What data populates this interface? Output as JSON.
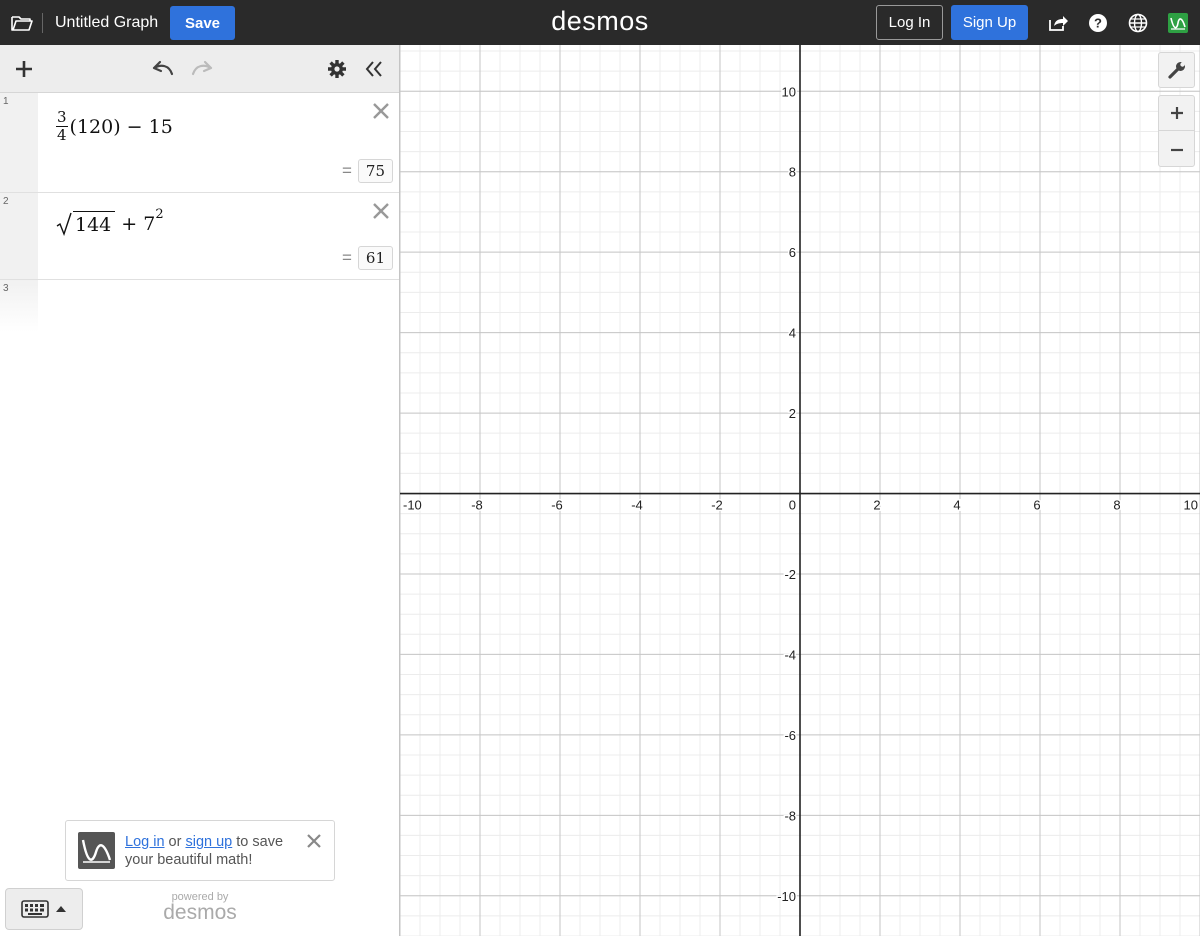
{
  "header": {
    "graph_title": "Untitled Graph",
    "save_label": "Save",
    "logo_text": "desmos",
    "login_label": "Log In",
    "signup_label": "Sign Up"
  },
  "expressions": [
    {
      "index": "1",
      "numerator": "3",
      "denominator": "4",
      "rest": "(120) − 15",
      "result": "75"
    },
    {
      "index": "2",
      "radicand": "144",
      "plus": "+ 7",
      "exponent": "2",
      "result": "61"
    },
    {
      "index": "3"
    }
  ],
  "eval_equals": "=",
  "toast": {
    "login_link": "Log in",
    "or_text": " or ",
    "signup_link": "sign up",
    "message": " to save your beautiful math!"
  },
  "powered": {
    "by_text": "powered by",
    "logo_text": "desmos"
  },
  "graph": {
    "x_ticks": [
      -10,
      -8,
      -6,
      -4,
      -2,
      0,
      2,
      4,
      6,
      8,
      10
    ],
    "y_ticks": [
      10,
      8,
      6,
      4,
      2,
      -2,
      -4,
      -6,
      -8,
      -10
    ],
    "x_range": [
      -10,
      10
    ],
    "y_range": [
      -11,
      11.15
    ],
    "major_step": 2,
    "minor_step": 0.5
  },
  "colors": {
    "accent": "#2f72dc",
    "header_bg": "#2a2a2a",
    "brand_green": "#2ea043"
  }
}
